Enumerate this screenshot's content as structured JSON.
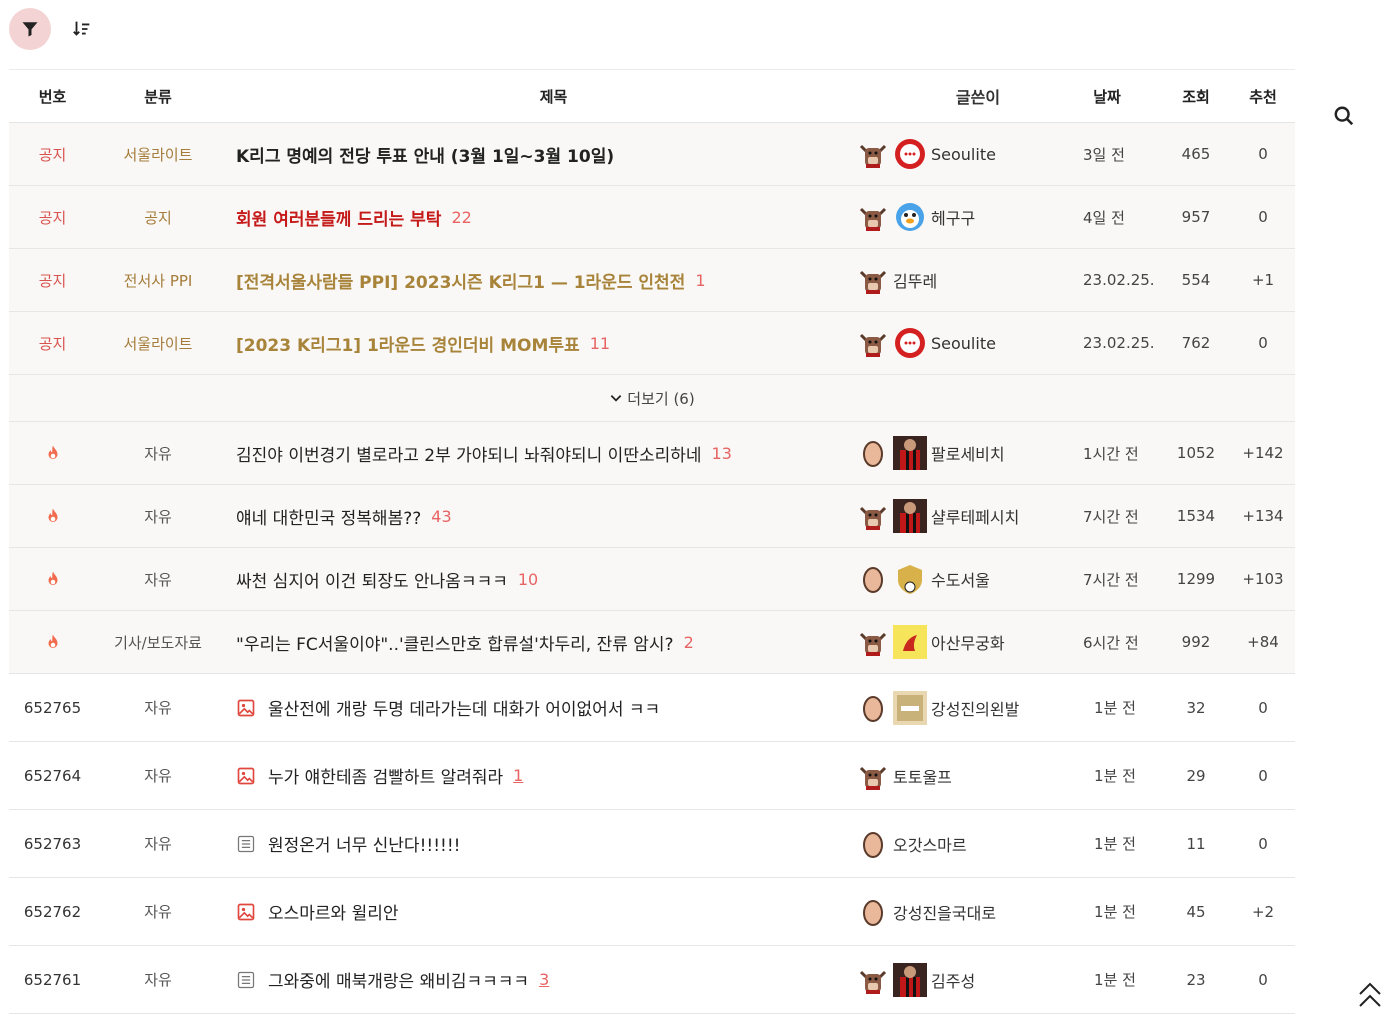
{
  "header": {
    "col_no": "번호",
    "col_category": "분류",
    "col_title": "제목",
    "col_author": "글쓴이",
    "col_date": "날짜",
    "col_views": "조회",
    "col_votes": "추천"
  },
  "notices": [
    {
      "no": "공지",
      "category": "서울라이트",
      "title": "K리그 명예의 전당 투표 안내 (3월 1일~3월 10일)",
      "comments": "",
      "author": "Seoulite",
      "date": "3일 전",
      "views": "465",
      "votes": "0"
    },
    {
      "no": "공지",
      "category": "공지",
      "title": "회원 여러분들께 드리는 부탁",
      "comments": "22",
      "author": "헤구구",
      "date": "4일 전",
      "views": "957",
      "votes": "0"
    },
    {
      "no": "공지",
      "category": "전서사 PPI",
      "title": "[전격서울사람들 PPI] 2023시즌 K리그1 — 1라운드 인천전",
      "comments": "1",
      "author": "김뚜레",
      "date": "23.02.25.",
      "views": "554",
      "votes": "+1"
    },
    {
      "no": "공지",
      "category": "서울라이트",
      "title": "[2023 K리그1] 1라운드 경인더비 MOM투표",
      "comments": "11",
      "author": "Seoulite",
      "date": "23.02.25.",
      "views": "762",
      "votes": "0"
    }
  ],
  "more": {
    "label": "더보기 (6)"
  },
  "hot_posts": [
    {
      "category": "자유",
      "title": "김진야 이번경기 별로라고 2부 가야되니 놔줘야되니 이딴소리하네",
      "comments": "13",
      "author": "팔로세비치",
      "date": "1시간 전",
      "views": "1052",
      "votes": "+142"
    },
    {
      "category": "자유",
      "title": "얘네 대한민국 정복해봄??",
      "comments": "43",
      "author": "샬루테페시치",
      "date": "7시간 전",
      "views": "1534",
      "votes": "+134"
    },
    {
      "category": "자유",
      "title": "싸천 심지어 이건 퇴장도 안나옴ㅋㅋㅋ",
      "comments": "10",
      "author": "수도서울",
      "date": "7시간 전",
      "views": "1299",
      "votes": "+103"
    },
    {
      "category": "기사/보도자료",
      "title": "\"우리는 FC서울이야\"..'클린스만호 합류설'차두리, 잔류 암시?",
      "comments": "2",
      "author": "아산무궁화",
      "date": "6시간 전",
      "views": "992",
      "votes": "+84"
    }
  ],
  "posts": [
    {
      "no": "652765",
      "category": "자유",
      "type": "image",
      "title": "울산전에 개랑 두명 데라가는데 대화가 어이없어서 ㅋㅋ",
      "comments": "",
      "author": "강성진의왼발",
      "date": "1분 전",
      "views": "32",
      "votes": "0"
    },
    {
      "no": "652764",
      "category": "자유",
      "type": "image",
      "title": "누가 얘한테좀 검빨하트 알려줘라",
      "comments": "1",
      "author": "토토울프",
      "date": "1분 전",
      "views": "29",
      "votes": "0"
    },
    {
      "no": "652763",
      "category": "자유",
      "type": "text",
      "title": "원정온거 너무 신난다!!!!!!",
      "comments": "",
      "author": "오갓스마르",
      "date": "1분 전",
      "views": "11",
      "votes": "0"
    },
    {
      "no": "652762",
      "category": "자유",
      "type": "image",
      "title": "오스마르와 윌리안",
      "comments": "",
      "author": "강성진을국대로",
      "date": "1분 전",
      "views": "45",
      "votes": "+2"
    },
    {
      "no": "652761",
      "category": "자유",
      "type": "text",
      "title": "그와중에 매북개랑은 왜비김ㅋㅋㅋㅋ",
      "comments": "3",
      "author": "김주성",
      "date": "1분 전",
      "views": "23",
      "votes": "0"
    }
  ],
  "colors": {
    "accent": "#d9534f",
    "notice_bg": "#f9f8f6",
    "filter_bg": "#f3d3d3",
    "gold": "#a8833a",
    "red_title": "#c51a1a",
    "comment": "#e86464"
  },
  "icons": {
    "filter": "filter-icon",
    "sort": "sort-icon",
    "search": "search-icon",
    "hot": "fire-icon",
    "image_post": "image-icon",
    "text_post": "document-icon",
    "scroll_top": "double-chevron-up-icon"
  }
}
